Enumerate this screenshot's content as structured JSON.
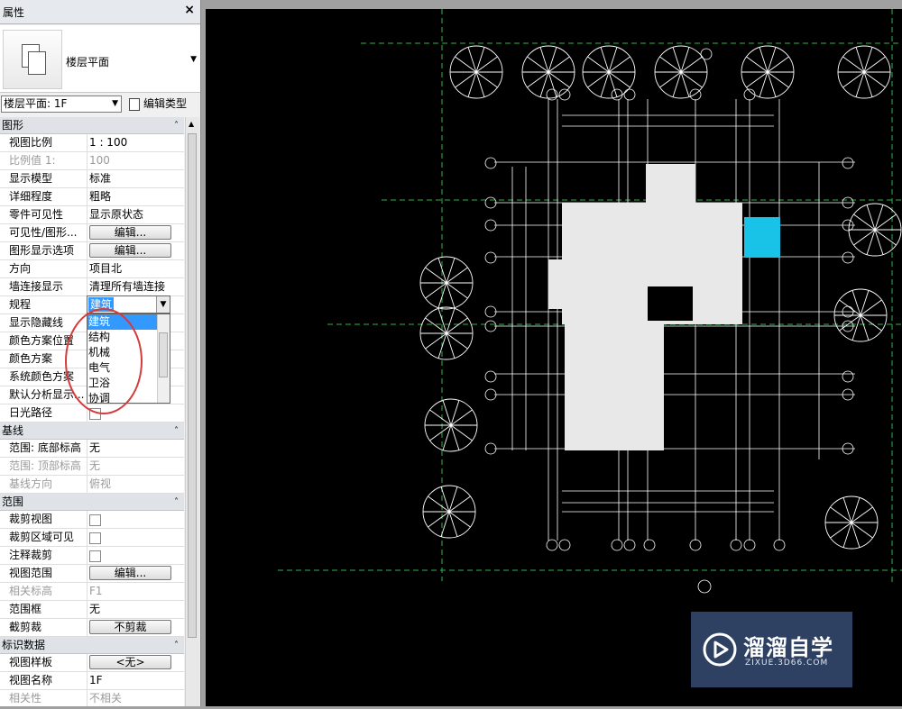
{
  "panel": {
    "title": "属性",
    "close": "×",
    "type_name": "楼层平面",
    "view_selector": "楼层平面: 1F",
    "edit_type": "编辑类型"
  },
  "groups": [
    {
      "name": "图形",
      "rows": [
        {
          "label": "视图比例",
          "value": "1 : 100"
        },
        {
          "label": "比例值 1:",
          "value": "100",
          "disabled": true
        },
        {
          "label": "显示模型",
          "value": "标准"
        },
        {
          "label": "详细程度",
          "value": "粗略"
        },
        {
          "label": "零件可见性",
          "value": "显示原状态"
        },
        {
          "label": "可见性/图形...",
          "button": "编辑..."
        },
        {
          "label": "图形显示选项",
          "button": "编辑..."
        },
        {
          "label": "方向",
          "value": "项目北"
        },
        {
          "label": "墙连接显示",
          "value": "清理所有墙连接"
        },
        {
          "label": "规程",
          "value": ""
        },
        {
          "label": "显示隐藏线",
          "value": ""
        },
        {
          "label": "颜色方案位置",
          "value": ""
        },
        {
          "label": "颜色方案",
          "value": ""
        },
        {
          "label": "系统颜色方案",
          "value": ""
        },
        {
          "label": "默认分析显示...",
          "value": ""
        },
        {
          "label": "日光路径",
          "checkbox": true
        }
      ]
    },
    {
      "name": "基线",
      "rows": [
        {
          "label": "范围: 底部标高",
          "value": "无"
        },
        {
          "label": "范围: 顶部标高",
          "value": "无",
          "disabled": true
        },
        {
          "label": "基线方向",
          "value": "俯视",
          "disabled": true
        }
      ]
    },
    {
      "name": "范围",
      "rows": [
        {
          "label": "裁剪视图",
          "checkbox": true
        },
        {
          "label": "裁剪区域可见",
          "checkbox": true
        },
        {
          "label": "注释裁剪",
          "checkbox": true
        },
        {
          "label": "视图范围",
          "button": "编辑..."
        },
        {
          "label": "相关标高",
          "value": "F1",
          "disabled": true
        },
        {
          "label": "范围框",
          "value": "无"
        },
        {
          "label": "截剪裁",
          "button": "不剪裁"
        }
      ]
    },
    {
      "name": "标识数据",
      "rows": [
        {
          "label": "视图样板",
          "button": "<无>"
        },
        {
          "label": "视图名称",
          "value": "1F"
        },
        {
          "label": "相关性",
          "value": "不相关",
          "disabled": true
        }
      ]
    }
  ],
  "dropdown": {
    "current": "建筑",
    "options": [
      "建筑",
      "结构",
      "机械",
      "电气",
      "卫浴",
      "协调"
    ],
    "selected_index": 0
  },
  "watermark": {
    "name": "溜溜自学",
    "url": "ZIXUE.3D66.COM"
  },
  "colors": {
    "canvas": "#000000",
    "selection": "#3399ff",
    "highlight_room": "#19c3e8",
    "grid_line": "#2fb24a",
    "annotation_circle": "#d43b3b",
    "watermark_bg": "#334669"
  }
}
